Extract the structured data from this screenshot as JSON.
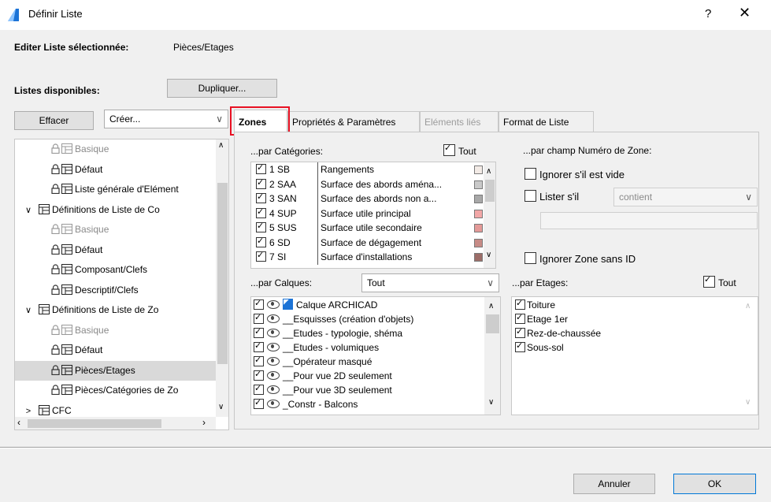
{
  "window": {
    "title": "Définir Liste",
    "help": "?",
    "close": "✕",
    "accent": "#0078d7"
  },
  "edit": {
    "label": "Editer Liste sélectionnée:",
    "value": "Pièces/Etages"
  },
  "lists_label": "Listes disponibles:",
  "buttons": {
    "duplicate": "Dupliquer...",
    "delete": "Effacer",
    "cancel": "Annuler",
    "ok": "OK"
  },
  "create_select": {
    "value": "Créer..."
  },
  "tree": [
    {
      "label": "Basique",
      "indent": 2,
      "dim": true,
      "expander": ""
    },
    {
      "label": "Défaut",
      "indent": 2,
      "dim": false,
      "expander": ""
    },
    {
      "label": "Liste générale d'Elément",
      "indent": 2,
      "dim": false,
      "expander": ""
    },
    {
      "label": "Définitions de Liste de Co",
      "indent": 1,
      "dim": false,
      "expander": "∨"
    },
    {
      "label": "Basique",
      "indent": 2,
      "dim": true,
      "expander": ""
    },
    {
      "label": "Défaut",
      "indent": 2,
      "dim": false,
      "expander": ""
    },
    {
      "label": "Composant/Clefs",
      "indent": 2,
      "dim": false,
      "expander": ""
    },
    {
      "label": "Descriptif/Clefs",
      "indent": 2,
      "dim": false,
      "expander": ""
    },
    {
      "label": "Définitions de Liste de Zo",
      "indent": 1,
      "dim": false,
      "expander": "∨"
    },
    {
      "label": "Basique",
      "indent": 2,
      "dim": true,
      "expander": ""
    },
    {
      "label": "Défaut",
      "indent": 2,
      "dim": false,
      "expander": ""
    },
    {
      "label": "Pièces/Etages",
      "indent": 2,
      "dim": false,
      "expander": "",
      "selected": true
    },
    {
      "label": "Pièces/Catégories de Zo",
      "indent": 2,
      "dim": false,
      "expander": ""
    },
    {
      "label": "CFC",
      "indent": 1,
      "dim": false,
      "expander": ">"
    }
  ],
  "tabs": [
    {
      "label": "Zones",
      "active": true,
      "disabled": false
    },
    {
      "label": "Propriétés & Paramètres",
      "active": false,
      "disabled": false
    },
    {
      "label": "Eléments liés",
      "active": false,
      "disabled": true
    },
    {
      "label": "Format de Liste",
      "active": false,
      "disabled": false
    }
  ],
  "categories": {
    "label": "...par Catégories:",
    "all_label": "Tout",
    "all_checked": true,
    "rows": [
      {
        "code": "1 SB",
        "name": "Rangements",
        "color": "#f3ebe6"
      },
      {
        "code": "2 SAA",
        "name": "Surface des abords aména...",
        "color": "#c9c9c9"
      },
      {
        "code": "3 SAN",
        "name": "Surface des abords non a...",
        "color": "#a8a8a8"
      },
      {
        "code": "4 SUP",
        "name": "Surface utile principal",
        "color": "#f2a7a7"
      },
      {
        "code": "5 SUS",
        "name": "Surface utile secondaire",
        "color": "#e49a98"
      },
      {
        "code": "6 SD",
        "name": "Surface de dégagement",
        "color": "#c78b86"
      },
      {
        "code": "7 SI",
        "name": "Surface d'installations",
        "color": "#9c6d68"
      }
    ]
  },
  "zone_number": {
    "label": "...par champ Numéro de Zone:",
    "ignore_empty": "Ignorer s'il est vide",
    "list_if": "Lister s'il",
    "condition": "contient",
    "ignore_no_id": "Ignorer Zone sans ID"
  },
  "layers": {
    "label": "...par Calques:",
    "filter": "Tout",
    "rows": [
      "Calque ARCHICAD",
      "__Esquisses (création d'objets)",
      "__Etudes - typologie, shéma",
      "__Etudes - volumiques",
      "__Opérateur masqué",
      "__Pour vue 2D seulement",
      "__Pour vue 3D seulement",
      "_Constr - Balcons"
    ]
  },
  "stories": {
    "label": "...par Etages:",
    "all_label": "Tout",
    "all_checked": true,
    "rows": [
      "Toiture",
      "Etage 1er",
      "Rez-de-chaussée",
      "Sous-sol"
    ]
  }
}
